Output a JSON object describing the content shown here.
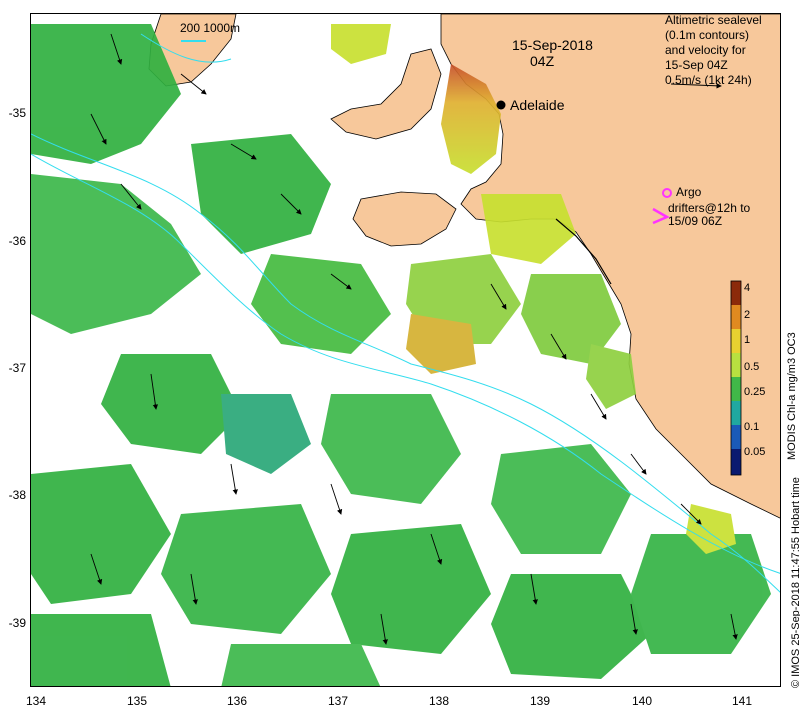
{
  "map": {
    "date": "15-Sep-2018",
    "time": "04Z",
    "city": "Adelaide",
    "scale_bar_label": "200   1000m",
    "legend": {
      "line1": "Altimetric sealevel",
      "line2": "(0.1m contours)",
      "line3": "and velocity for",
      "line4": "15-Sep 04Z",
      "line5": "0.5m/s (1kt 24h)"
    },
    "argo_label": "Argo",
    "drifters_line1": "drifters@12h to",
    "drifters_line2": "15/09 06Z",
    "colorbar": {
      "title": "MODIS Chl-a mg/m3 OC3",
      "ticks": [
        "4",
        "2",
        "1",
        "0.5",
        "0.25",
        "0.1",
        "0.05"
      ]
    },
    "credit": "© IMOS 25-Sep-2018 11:47:55 Hobart time",
    "x_ticks": [
      "134",
      "135",
      "136",
      "137",
      "138",
      "139",
      "140",
      "141"
    ],
    "y_ticks": [
      "-35",
      "-36",
      "-37",
      "-38",
      "-39"
    ],
    "colors": {
      "land": "#f7c89b",
      "contour": "#33ddee",
      "high_chl": "#c0502a",
      "mid_chl": "#c8e030",
      "low_chl": "#30b040",
      "argo": "#ff33ff"
    }
  }
}
